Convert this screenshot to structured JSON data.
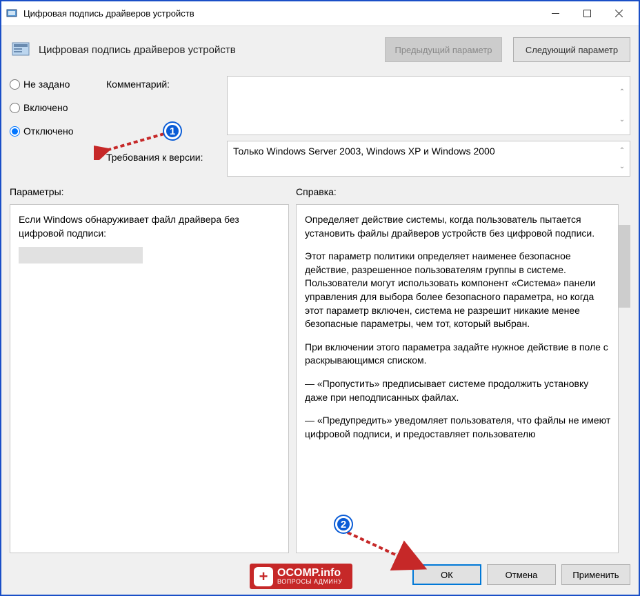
{
  "window": {
    "title": "Цифровая подпись драйверов устройств"
  },
  "header": {
    "title": "Цифровая подпись драйверов устройств",
    "prev_label": "Предыдущий параметр",
    "next_label": "Следующий параметр"
  },
  "radios": {
    "not_configured": "Не задано",
    "enabled": "Включено",
    "disabled": "Отключено",
    "selected": "disabled"
  },
  "labels": {
    "comment": "Комментарий:",
    "supported": "Требования к версии:",
    "options": "Параметры:",
    "help": "Справка:"
  },
  "supported_text": "Только Windows Server 2003, Windows XP и Windows 2000",
  "options_text": "Если Windows обнаруживает файл драйвера без цифровой подписи:",
  "help_paragraphs": [
    "Определяет действие системы, когда пользователь пытается установить файлы драйверов устройств без цифровой подписи.",
    "Этот параметр политики определяет наименее безопасное действие, разрешенное пользователям группы в системе. Пользователи могут использовать компонент «Система» панели управления для выбора более безопасного параметра, но когда этот параметр включен, система не разрешит никакие менее безопасные параметры, чем тот, который выбран.",
    "При включении этого параметра задайте нужное действие в поле с раскрывающимся списком.",
    "— «Пропустить» предписывает системе продолжить установку даже при неподписанных файлах.",
    "— «Предупредить» уведомляет пользователя, что файлы не имеют цифровой подписи, и предоставляет пользователю"
  ],
  "footer": {
    "ok": "ОК",
    "cancel": "Отмена",
    "apply": "Применить"
  },
  "annotations": {
    "marker1": "1",
    "marker2": "2"
  },
  "logo": {
    "main": "OCOMP.info",
    "sub": "ВОПРОСЫ АДМИНУ"
  }
}
